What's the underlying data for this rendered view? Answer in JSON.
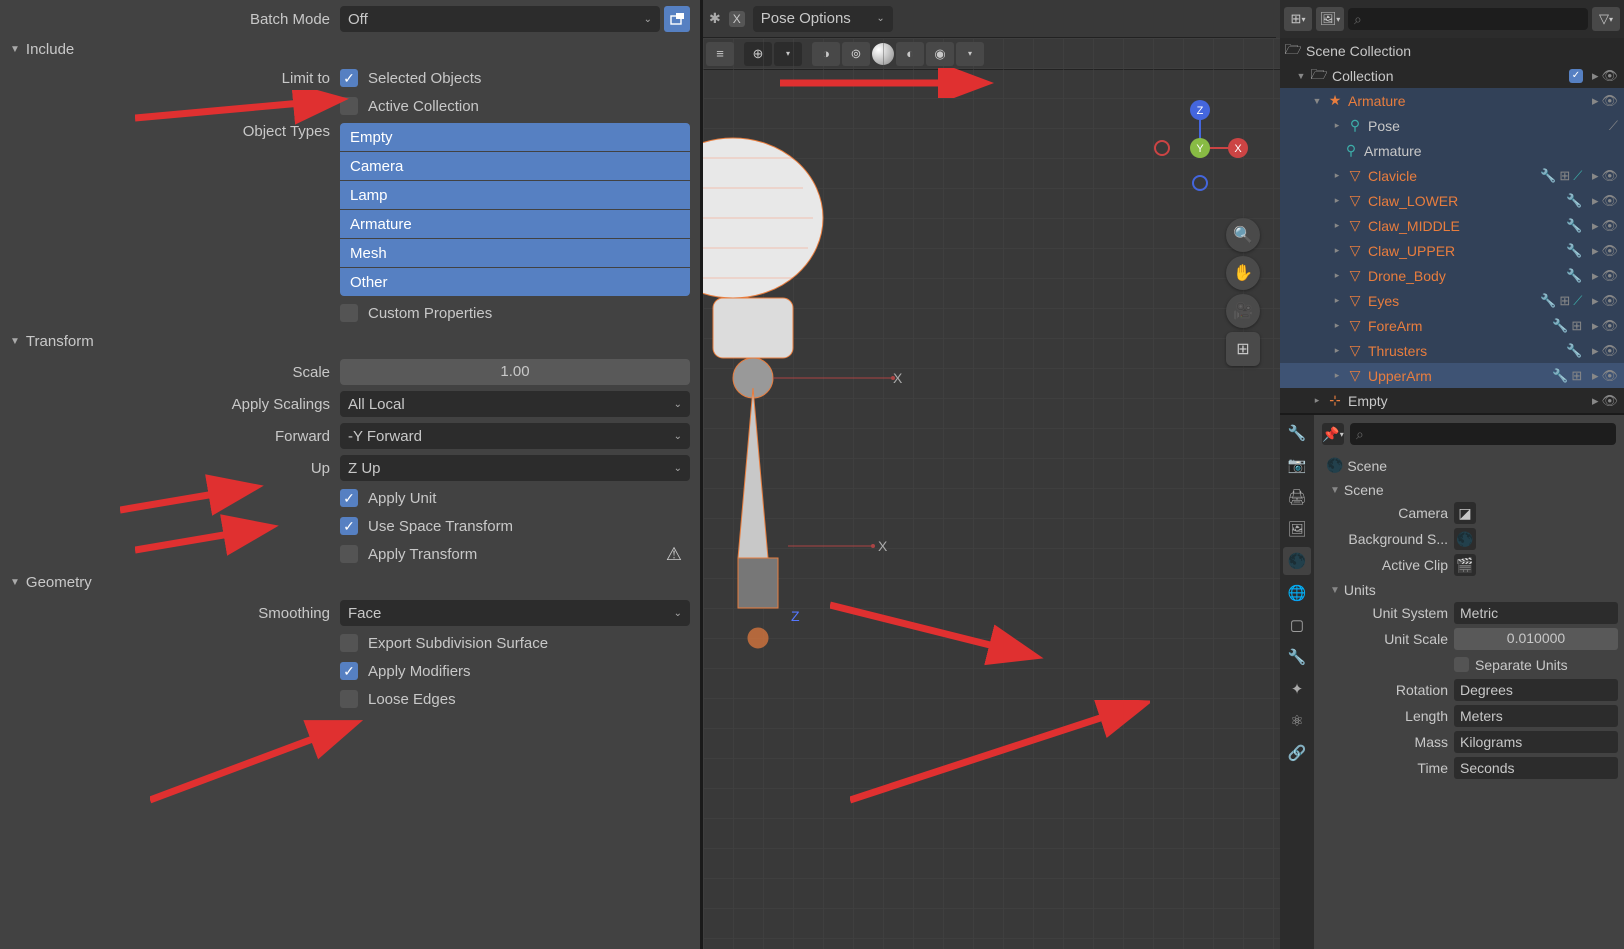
{
  "export": {
    "batch_mode_label": "Batch Mode",
    "batch_mode_value": "Off",
    "sections": {
      "include": "Include",
      "transform": "Transform",
      "geometry": "Geometry"
    },
    "limit_to_label": "Limit to",
    "limit_selected_objects": "Selected Objects",
    "limit_active_collection": "Active Collection",
    "object_types_label": "Object Types",
    "object_types": [
      "Empty",
      "Camera",
      "Lamp",
      "Armature",
      "Mesh",
      "Other"
    ],
    "custom_properties": "Custom Properties",
    "scale_label": "Scale",
    "scale_value": "1.00",
    "apply_scalings_label": "Apply Scalings",
    "apply_scalings_value": "All Local",
    "forward_label": "Forward",
    "forward_value": "-Y Forward",
    "up_label": "Up",
    "up_value": "Z Up",
    "apply_unit": "Apply Unit",
    "use_space_transform": "Use Space Transform",
    "apply_transform": "Apply Transform",
    "smoothing_label": "Smoothing",
    "smoothing_value": "Face",
    "export_subsurf": "Export Subdivision Surface",
    "apply_modifiers": "Apply Modifiers",
    "loose_edges": "Loose Edges"
  },
  "viewport": {
    "header_dropdown": "Pose Options",
    "axis_x": "X",
    "axis_z": "Z",
    "gizmo": {
      "x": "X",
      "y": "Y",
      "z": "Z"
    }
  },
  "outliner": {
    "scene_collection": "Scene Collection",
    "collection": "Collection",
    "armature": "Armature",
    "pose": "Pose",
    "armature2": "Armature",
    "items": [
      {
        "name": "Clavicle"
      },
      {
        "name": "Claw_LOWER"
      },
      {
        "name": "Claw_MIDDLE"
      },
      {
        "name": "Claw_UPPER"
      },
      {
        "name": "Drone_Body"
      },
      {
        "name": "Eyes"
      },
      {
        "name": "ForeArm"
      },
      {
        "name": "Thrusters"
      },
      {
        "name": "UpperArm"
      }
    ],
    "empty": "Empty"
  },
  "properties": {
    "breadcrumb": "Scene",
    "scene_section": "Scene",
    "camera_label": "Camera",
    "background_label": "Background S...",
    "active_clip_label": "Active Clip",
    "units_section": "Units",
    "unit_system_label": "Unit System",
    "unit_system_value": "Metric",
    "unit_scale_label": "Unit Scale",
    "unit_scale_value": "0.010000",
    "separate_units": "Separate Units",
    "rotation_label": "Rotation",
    "rotation_value": "Degrees",
    "length_label": "Length",
    "length_value": "Meters",
    "mass_label": "Mass",
    "mass_value": "Kilograms",
    "time_label": "Time",
    "time_value": "Seconds"
  }
}
